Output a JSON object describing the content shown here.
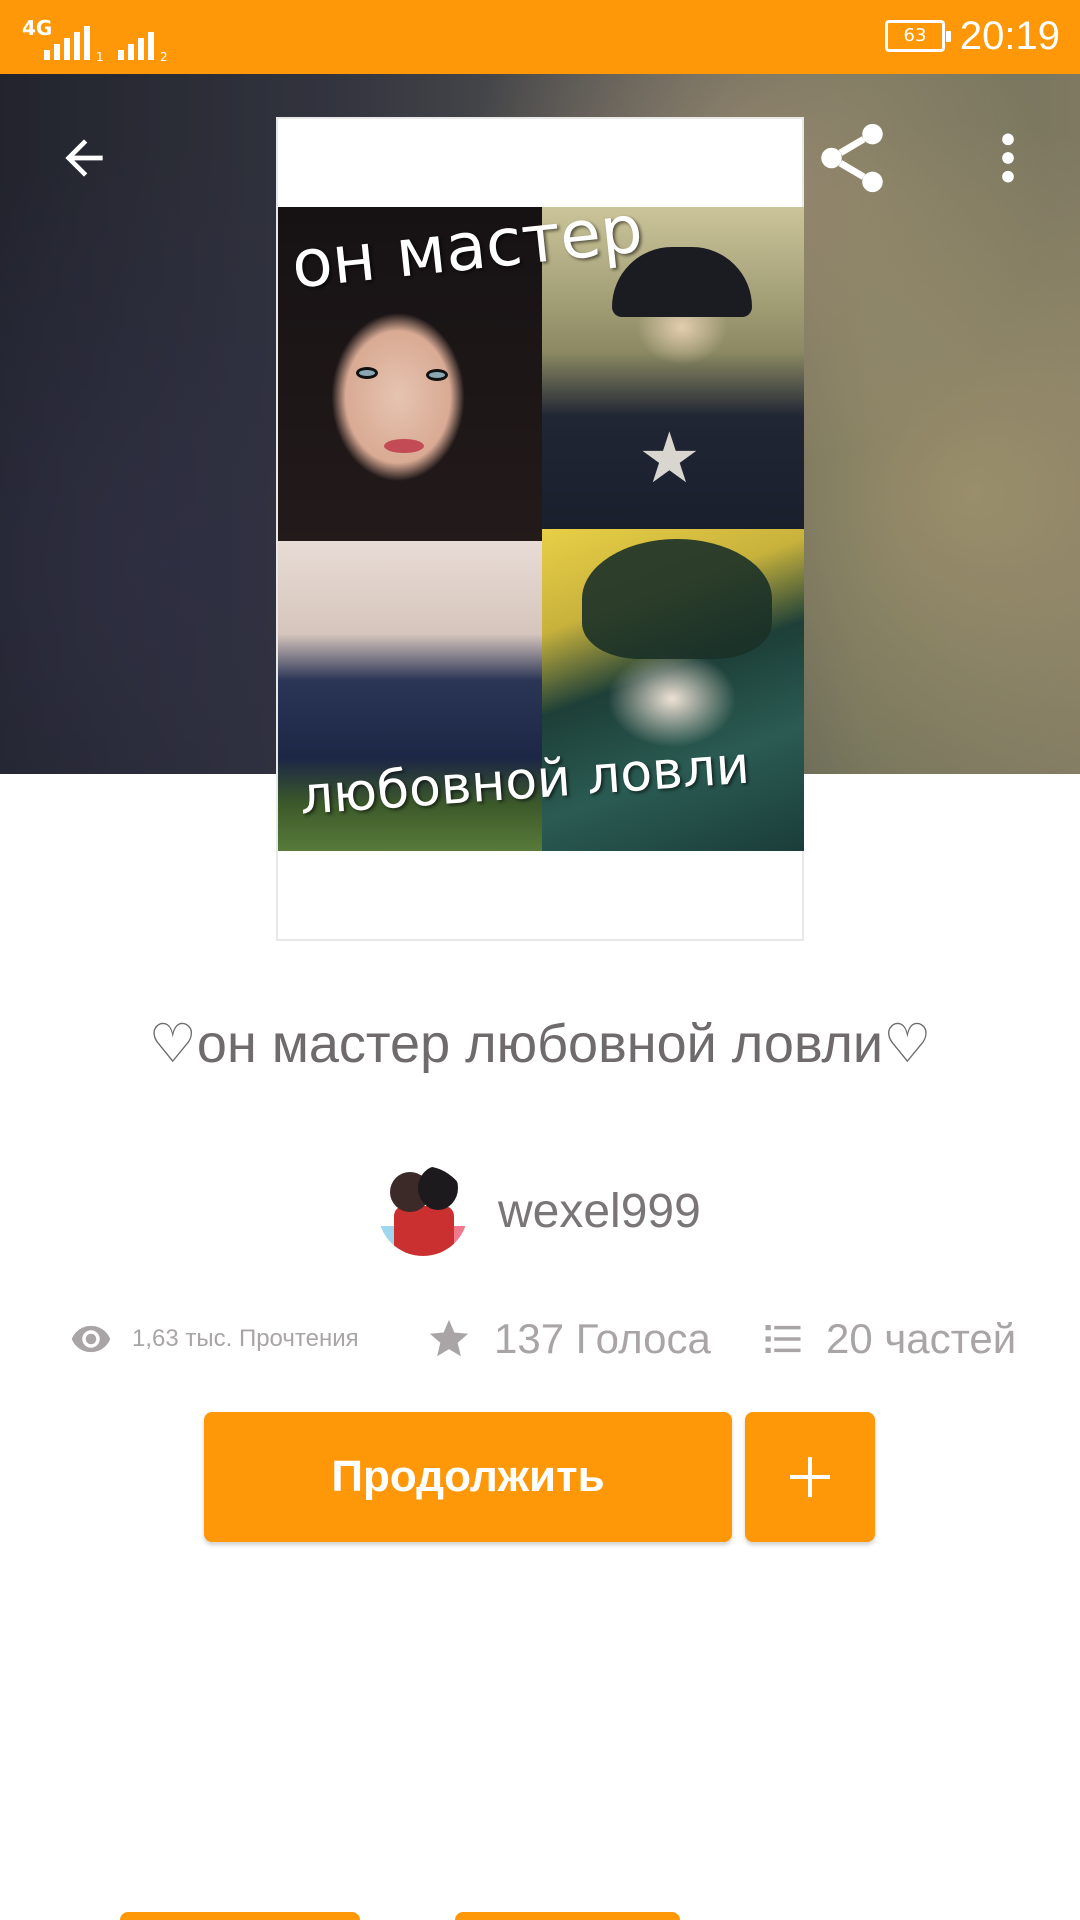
{
  "status_bar": {
    "network": "4G",
    "sim1_index": "1",
    "sim2_index": "2",
    "battery_level": "63",
    "time": "20:19",
    "background_color": "#FF9808"
  },
  "toolbar": {
    "back_icon": "arrow-left-icon",
    "share_icon": "share-icon",
    "more_icon": "more-vertical-icon"
  },
  "cover": {
    "text_top": "он мастер",
    "text_bottom": "любовной ловли"
  },
  "story": {
    "title": "♡он мастер любовной ловли♡",
    "author": "wexel999"
  },
  "stats": {
    "reads": "1,63 тыс. Прочтения",
    "reads_icon": "eye-icon",
    "votes": "137 Голоса",
    "votes_icon": "star-icon",
    "parts": "20 частей",
    "parts_icon": "list-icon"
  },
  "actions": {
    "continue_label": "Продолжить",
    "add_icon": "plus-icon",
    "accent_color": "#FF9808"
  }
}
